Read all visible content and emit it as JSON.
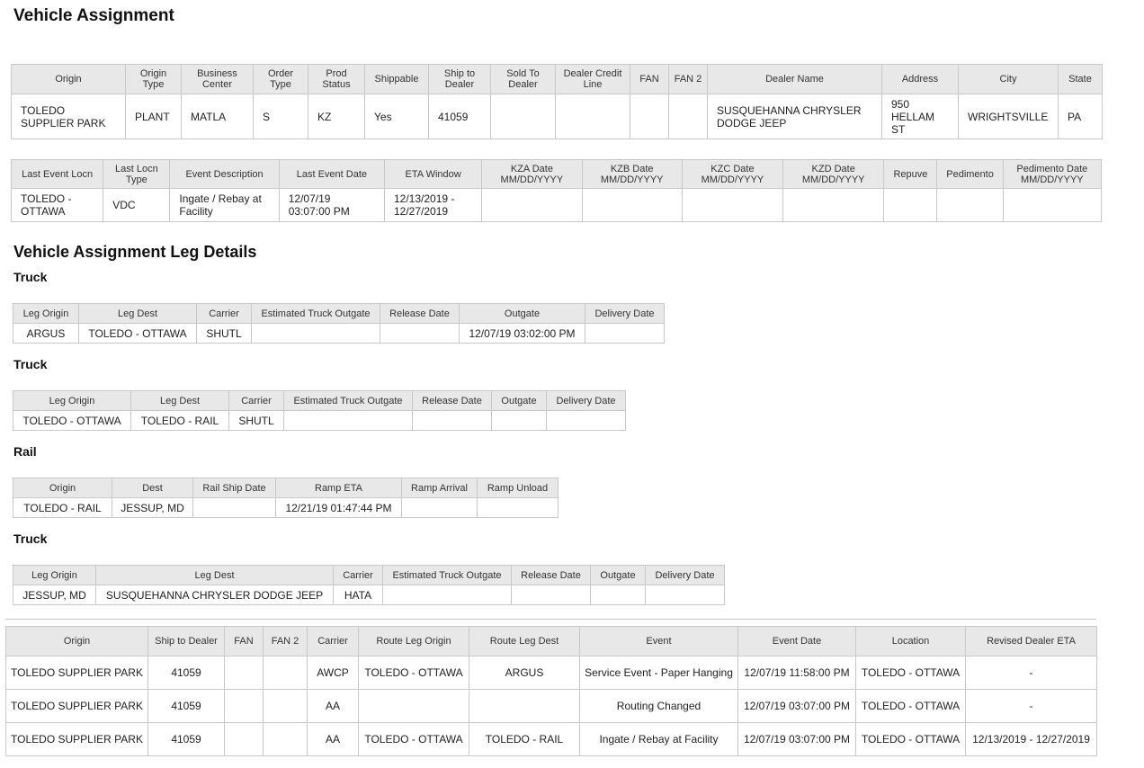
{
  "page_title": "Vehicle Assignment",
  "assignment": {
    "headers": [
      "Origin",
      "Origin Type",
      "Business Center",
      "Order Type",
      "Prod Status",
      "Shippable",
      "Ship to Dealer",
      "Sold To Dealer",
      "Dealer Credit Line",
      "FAN",
      "FAN 2",
      "Dealer Name",
      "Address",
      "City",
      "State"
    ],
    "row": [
      "TOLEDO SUPPLIER PARK",
      "PLANT",
      "MATLA",
      "S",
      "KZ",
      "Yes",
      "41059",
      "",
      "",
      "",
      "",
      "SUSQUEHANNA CHRYSLER DODGE JEEP",
      "950 HELLAM ST",
      "WRIGHTSVILLE",
      "PA"
    ]
  },
  "events": {
    "headers": [
      "Last Event Locn",
      "Last Locn Type",
      "Event Description",
      "Last Event Date",
      "ETA Window",
      "KZA Date MM/DD/YYYY",
      "KZB Date MM/DD/YYYY",
      "KZC Date MM/DD/YYYY",
      "KZD Date MM/DD/YYYY",
      "Repuve",
      "Pedimento",
      "Pedimento Date MM/DD/YYYY"
    ],
    "row": [
      "TOLEDO - OTTAWA",
      "VDC",
      "Ingate / Rebay at Facility",
      "12/07/19 03:07:00 PM",
      "12/13/2019 - 12/27/2019",
      "",
      "",
      "",
      "",
      "",
      "",
      ""
    ]
  },
  "leg_details_title": "Vehicle Assignment Leg Details",
  "legs": [
    {
      "title": "Truck",
      "headers": [
        "Leg Origin",
        "Leg Dest",
        "Carrier",
        "Estimated Truck Outgate",
        "Release Date",
        "Outgate",
        "Delivery Date"
      ],
      "row": [
        "ARGUS",
        "TOLEDO - OTTAWA",
        "SHUTL",
        "",
        "",
        "12/07/19 03:02:00 PM",
        ""
      ]
    },
    {
      "title": "Truck",
      "headers": [
        "Leg Origin",
        "Leg Dest",
        "Carrier",
        "Estimated Truck Outgate",
        "Release Date",
        "Outgate",
        "Delivery Date"
      ],
      "row": [
        "TOLEDO - OTTAWA",
        "TOLEDO - RAIL",
        "SHUTL",
        "",
        "",
        "",
        ""
      ]
    },
    {
      "title": "Rail",
      "headers": [
        "Origin",
        "Dest",
        "Rail Ship Date",
        "Ramp ETA",
        "Ramp Arrival",
        "Ramp Unload"
      ],
      "row": [
        "TOLEDO - RAIL",
        "JESSUP, MD",
        "",
        "12/21/19 01:47:44 PM",
        "",
        ""
      ]
    },
    {
      "title": "Truck",
      "headers": [
        "Leg Origin",
        "Leg Dest",
        "Carrier",
        "Estimated Truck Outgate",
        "Release Date",
        "Outgate",
        "Delivery Date"
      ],
      "row": [
        "JESSUP, MD",
        "SUSQUEHANNA CHRYSLER DODGE JEEP",
        "HATA",
        "",
        "",
        "",
        ""
      ]
    }
  ],
  "history": {
    "headers": [
      "Origin",
      "Ship to Dealer",
      "FAN",
      "FAN 2",
      "Carrier",
      "Route Leg Origin",
      "Route Leg Dest",
      "Event",
      "Event Date",
      "Location",
      "Revised Dealer ETA"
    ],
    "rows": [
      [
        "TOLEDO SUPPLIER PARK",
        "41059",
        "",
        "",
        "AWCP",
        "TOLEDO - OTTAWA",
        "ARGUS",
        "Service Event - Paper Hanging",
        "12/07/19 11:58:00 PM",
        "TOLEDO - OTTAWA",
        "-"
      ],
      [
        "TOLEDO SUPPLIER PARK",
        "41059",
        "",
        "",
        "AA",
        "",
        "",
        "Routing Changed",
        "12/07/19 03:07:00 PM",
        "TOLEDO - OTTAWA",
        "-"
      ],
      [
        "TOLEDO SUPPLIER PARK",
        "41059",
        "",
        "",
        "AA",
        "TOLEDO - OTTAWA",
        "TOLEDO - RAIL",
        "Ingate / Rebay at Facility",
        "12/07/19 03:07:00 PM",
        "TOLEDO - OTTAWA",
        "12/13/2019 - 12/27/2019"
      ]
    ]
  }
}
